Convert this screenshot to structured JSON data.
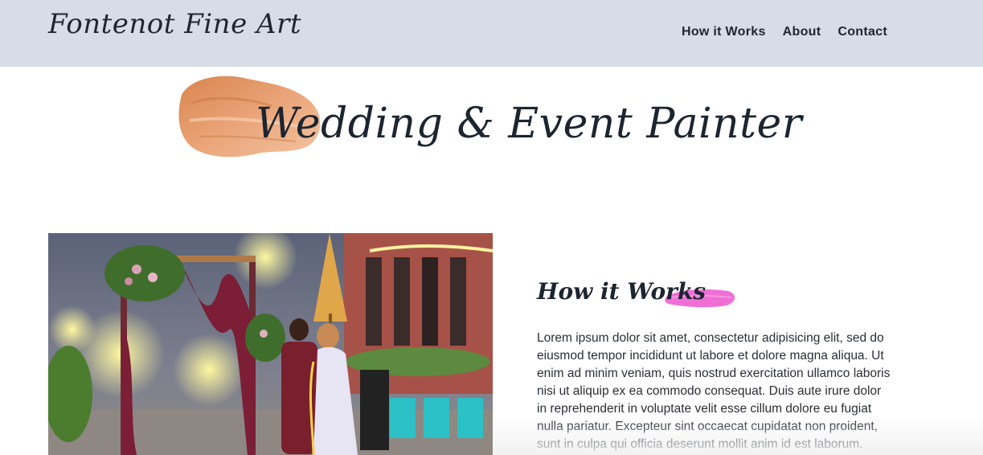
{
  "header": {
    "brand": "Fontenot Fine Art",
    "nav": [
      {
        "label": "How it Works"
      },
      {
        "label": "About"
      },
      {
        "label": "Contact"
      }
    ]
  },
  "hero": {
    "title": "Wedding & Event Painter",
    "accent_color": "#e49a6c"
  },
  "section": {
    "title": "How it Works",
    "accent_color": "#f06fd6",
    "body": "Lorem ipsum dolor sit amet, consectetur adipisicing elit, sed do eiusmod tempor incididunt ut labore et dolore magna aliqua. Ut enim ad minim veniam, quis nostrud exercitation ullamco laboris nisi ut aliquip ex ea commodo consequat. Duis aute irure dolor in reprehenderit in voluptate velit esse cillum dolore eu fugiat nulla pariatur. Excepteur sint occaecat cupidatat non proident, sunt in culpa qui officia deserunt mollit anim id est laborum."
  },
  "colors": {
    "header_bg": "#d6dde6",
    "text": "#1c2530"
  }
}
